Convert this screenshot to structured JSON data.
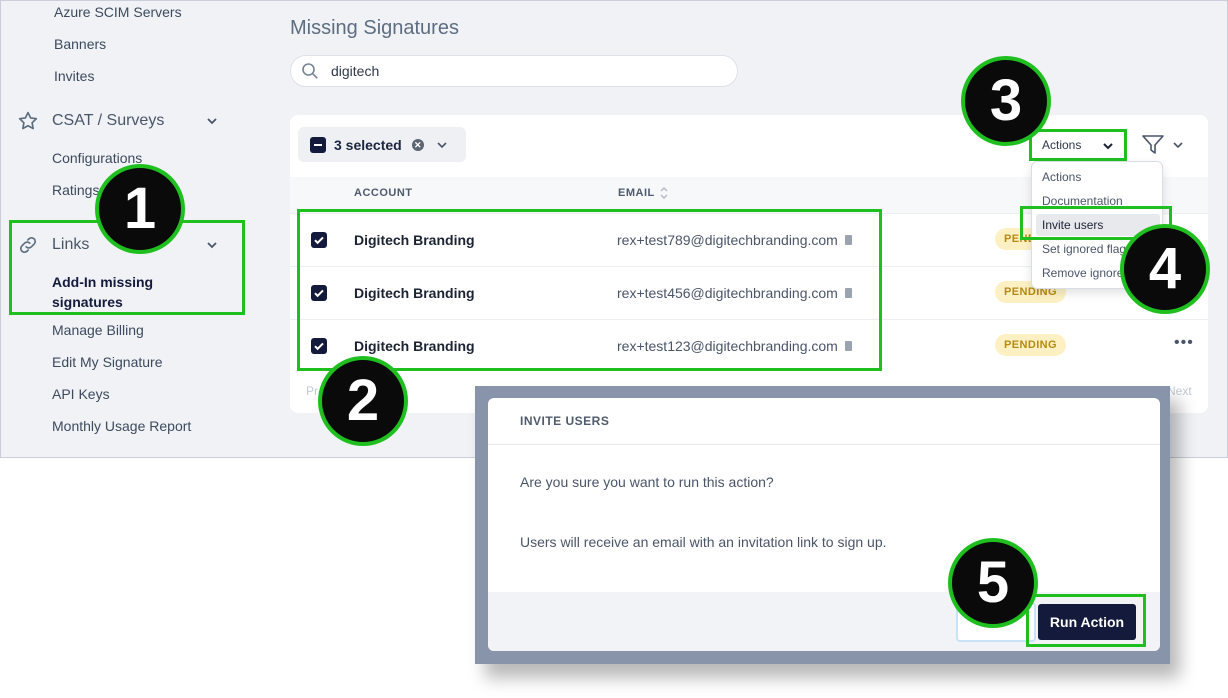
{
  "sidebar": {
    "top_links": [
      "Azure SCIM Servers",
      "Banners",
      "Invites"
    ],
    "csat": {
      "label": "CSAT / Surveys",
      "items": [
        "Configurations",
        "Ratings"
      ]
    },
    "links": {
      "label": "Links",
      "items": [
        "Add-In missing signatures",
        "Manage Billing",
        "Edit My Signature",
        "API Keys",
        "Monthly Usage Report"
      ]
    }
  },
  "page": {
    "title": "Missing Signatures"
  },
  "search": {
    "value": "digitech"
  },
  "table": {
    "selected_label": "3 selected",
    "columns": [
      "ACCOUNT",
      "EMAIL"
    ],
    "rows": [
      {
        "account": "Digitech Branding",
        "email": "rex+test789@digitechbranding.com",
        "status": "PENDING"
      },
      {
        "account": "Digitech Branding",
        "email": "rex+test456@digitechbranding.com",
        "status": "PENDING"
      },
      {
        "account": "Digitech Branding",
        "email": "rex+test123@digitechbranding.com",
        "status": "PENDING"
      }
    ],
    "pagination_prev": "Pr",
    "pagination_next": "Next"
  },
  "actions": {
    "button_label": "Actions",
    "menu": [
      "Actions",
      "Documentation",
      "Invite users",
      "Set ignored flag",
      "Remove ignore"
    ]
  },
  "modal": {
    "title": "INVITE USERS",
    "question": "Are you sure you want to run this action?",
    "info": "Users will receive an email with an invitation link to sign up.",
    "run_label": "Run Action"
  },
  "callouts": [
    "1",
    "2",
    "3",
    "4",
    "5"
  ],
  "colors": {
    "highlight": "#1fbf1f",
    "primary": "#141a3c",
    "badge_bg": "#fdf1c4",
    "badge_text": "#b88a12"
  }
}
